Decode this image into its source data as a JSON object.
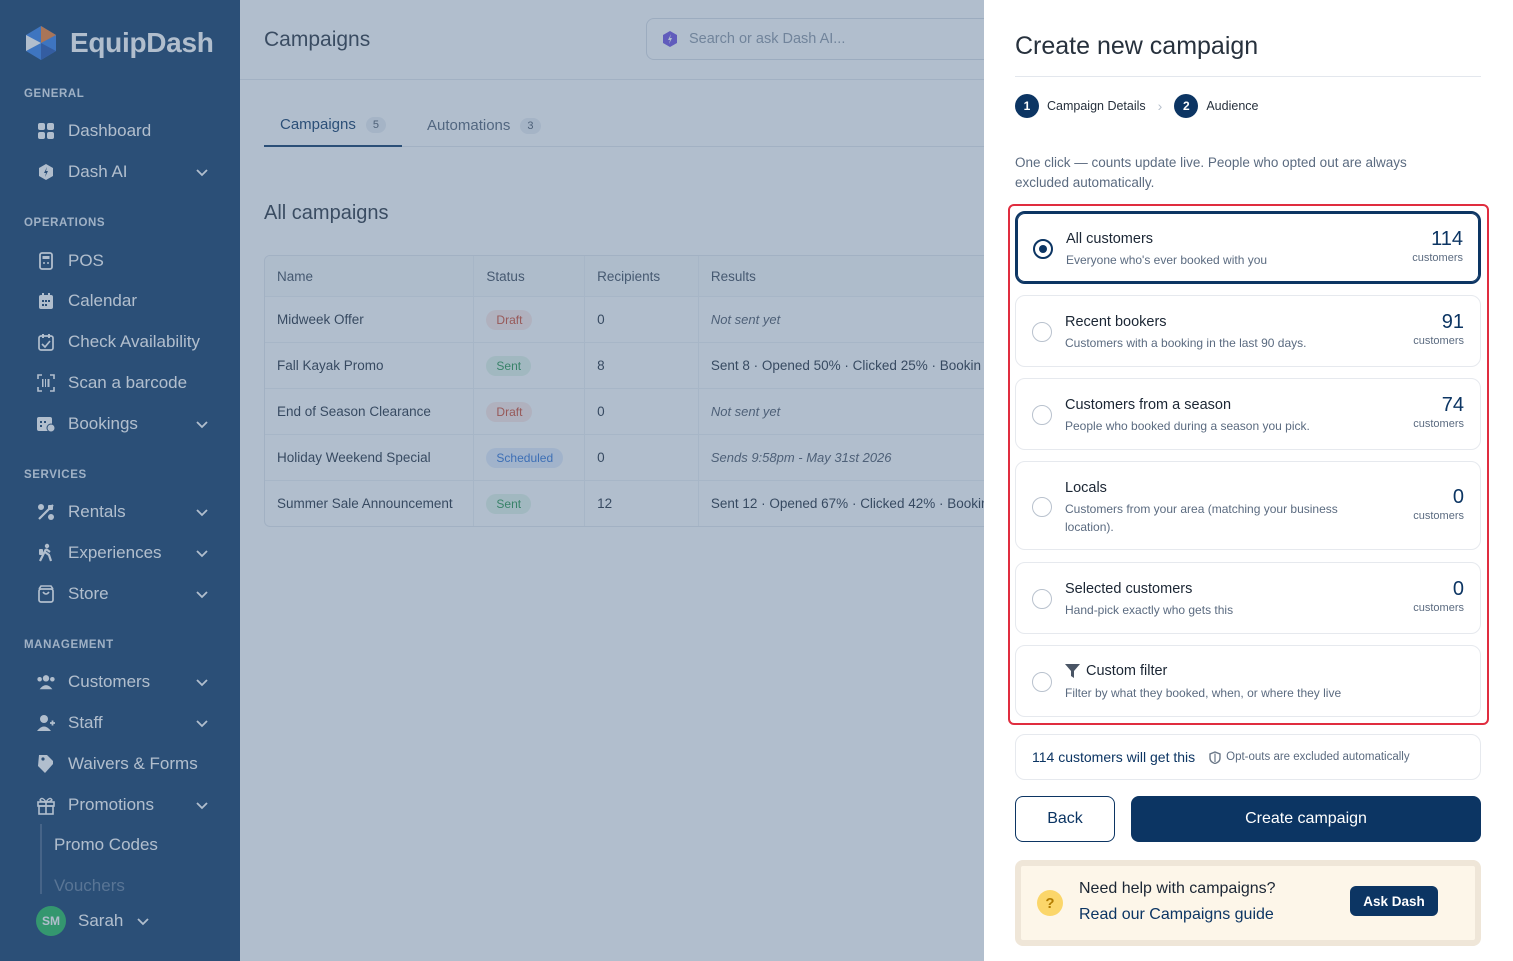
{
  "app": {
    "brand": "EquipDash"
  },
  "sidebar": {
    "sections": {
      "general": "GENERAL",
      "operations": "OPERATIONS",
      "services": "SERVICES",
      "management": "MANAGEMENT"
    },
    "items": {
      "dashboard": "Dashboard",
      "dash_ai": "Dash AI",
      "pos": "POS",
      "calendar": "Calendar",
      "check_availability": "Check Availability",
      "scan_barcode": "Scan a barcode",
      "bookings": "Bookings",
      "rentals": "Rentals",
      "experiences": "Experiences",
      "store": "Store",
      "customers": "Customers",
      "staff": "Staff",
      "waivers": "Waivers & Forms",
      "promotions": "Promotions",
      "promo_codes": "Promo Codes",
      "vouchers": "Vouchers"
    },
    "user": {
      "initials": "SM",
      "name": "Sarah"
    }
  },
  "header": {
    "title": "Campaigns",
    "search_placeholder": "Search or ask Dash AI..."
  },
  "tabs": [
    {
      "label": "Campaigns",
      "count": "5"
    },
    {
      "label": "Automations",
      "count": "3"
    }
  ],
  "campaigns": {
    "section_title": "All campaigns",
    "columns": [
      "Name",
      "Status",
      "Recipients",
      "Results"
    ],
    "rows": [
      {
        "name": "Midweek Offer",
        "status": "Draft",
        "recipients": "0",
        "results": "Not sent yet"
      },
      {
        "name": "Fall Kayak Promo",
        "status": "Sent",
        "recipients": "8",
        "results": "Sent 8 · Opened 50% · Clicked 25% · Bookin"
      },
      {
        "name": "End of Season Clearance",
        "status": "Draft",
        "recipients": "0",
        "results": "Not sent yet"
      },
      {
        "name": "Holiday Weekend Special",
        "status": "Scheduled",
        "recipients": "0",
        "results": "Sends 9:58pm - May 31st 2026"
      },
      {
        "name": "Summer Sale Announcement",
        "status": "Sent",
        "recipients": "12",
        "results": "Sent 12 · Opened 67% · Clicked 42% · Bookin"
      }
    ]
  },
  "drawer": {
    "title": "Create new campaign",
    "steps": [
      {
        "num": "1",
        "label": "Campaign Details"
      },
      {
        "num": "2",
        "label": "Audience"
      }
    ],
    "intro": "One click — counts update live. People who opted out are always excluded automatically.",
    "options": [
      {
        "title": "All customers",
        "desc": "Everyone who's ever booked with you",
        "count": "114",
        "unit": "customers"
      },
      {
        "title": "Recent bookers",
        "desc": "Customers with a booking in the last 90 days.",
        "count": "91",
        "unit": "customers"
      },
      {
        "title": "Customers from a season",
        "desc": "People who booked during a season you pick.",
        "count": "74",
        "unit": "customers"
      },
      {
        "title": "Locals",
        "desc": "Customers from your area (matching your business location).",
        "count": "0",
        "unit": "customers"
      },
      {
        "title": "Selected customers",
        "desc": "Hand-pick exactly who gets this",
        "count": "0",
        "unit": "customers"
      },
      {
        "title": "Custom filter",
        "desc": "Filter by what they booked, when, or where they live"
      }
    ],
    "summary": {
      "count_text": "114 customers will get this",
      "optout_text": "Opt-outs are excluded automatically"
    },
    "back_label": "Back",
    "create_label": "Create campaign",
    "help": {
      "title": "Need help with campaigns?",
      "link": "Read our Campaigns guide",
      "button": "Ask Dash"
    }
  }
}
